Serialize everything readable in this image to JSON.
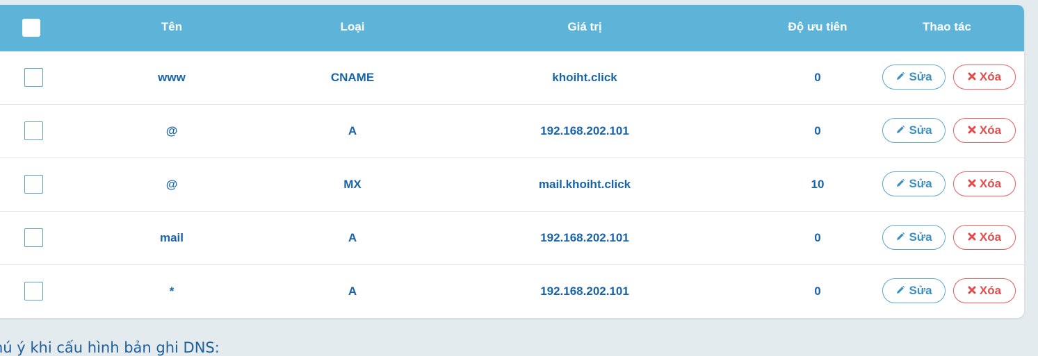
{
  "table": {
    "headers": {
      "name": "Tên",
      "type": "Loại",
      "value": "Giá trị",
      "priority": "Độ ưu tiên",
      "actions": "Thao tác"
    },
    "rows": [
      {
        "name": "www",
        "type": "CNAME",
        "value": "khoiht.click",
        "priority": "0"
      },
      {
        "name": "@",
        "type": "A",
        "value": "192.168.202.101",
        "priority": "0"
      },
      {
        "name": "@",
        "type": "MX",
        "value": "mail.khoiht.click",
        "priority": "10"
      },
      {
        "name": "mail",
        "type": "A",
        "value": "192.168.202.101",
        "priority": "0"
      },
      {
        "name": "*",
        "type": "A",
        "value": "192.168.202.101",
        "priority": "0"
      }
    ],
    "edit_label": "Sửa",
    "delete_label": "Xóa",
    "edit_icon": "pencil-icon",
    "delete_icon": "x-icon"
  },
  "note": {
    "text": "hú ý khi cấu hình bản ghi DNS:"
  },
  "colors": {
    "header_bg": "#5eb3d8",
    "text_primary": "#1964a8",
    "edit": "#3a8ec0",
    "delete": "#e54b4b",
    "page_bg": "#e4ebee"
  }
}
